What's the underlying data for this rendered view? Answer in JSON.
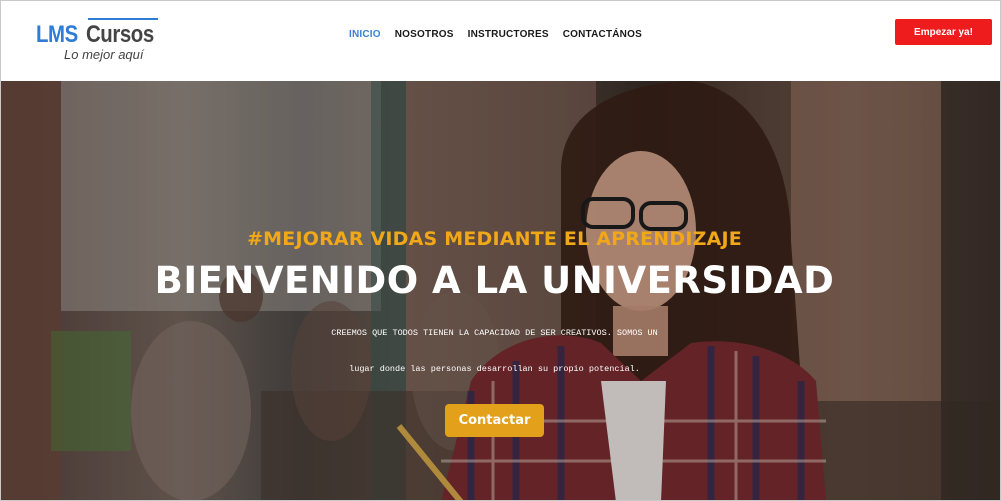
{
  "header": {
    "logo": {
      "word1": "LMS",
      "word2": "Cursos",
      "tagline": "Lo mejor aquí"
    },
    "nav": [
      {
        "label": "INICIO",
        "active": true
      },
      {
        "label": "NOSOTROS",
        "active": false
      },
      {
        "label": "INSTRUCTORES",
        "active": false
      },
      {
        "label": "CONTACTÁNOS",
        "active": false
      }
    ],
    "cta_label": "Empezar ya!"
  },
  "hero": {
    "hashtag": "#MEJORAR VIDAS MEDIANTE EL APRENDIZAJE",
    "headline": "BIENVENIDO A LA UNIVERSIDAD",
    "description_line1": "CREEMOS QUE TODOS TIENEN LA CAPACIDAD DE SER CREATIVOS. SOMOS UN",
    "description_line2": "lugar donde las personas desarrollan su propio potencial.",
    "cta_label": "Contactar"
  },
  "colors": {
    "accent_blue": "#2e7cd6",
    "cta_red": "#ee1c1c",
    "hero_gold": "#f0a818",
    "button_gold": "#e3a01a"
  }
}
